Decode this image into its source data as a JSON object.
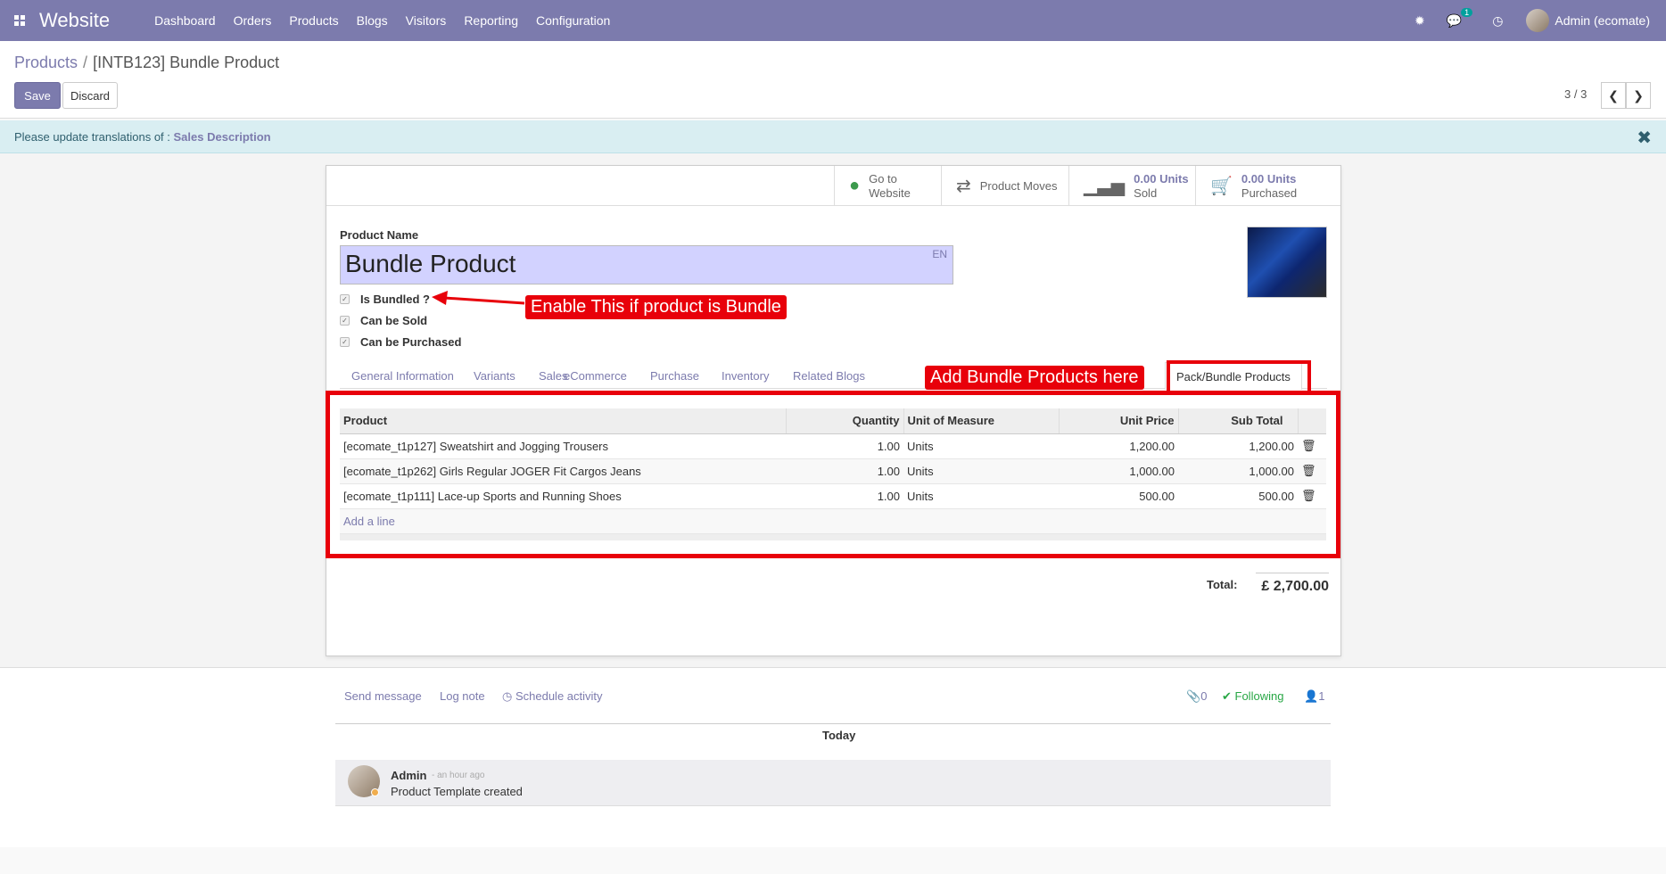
{
  "nav": {
    "brand": "Website",
    "menu": [
      "Dashboard",
      "Orders",
      "Products",
      "Blogs",
      "Visitors",
      "Reporting",
      "Configuration"
    ],
    "messages_badge": "1",
    "user": "Admin (ecomate)"
  },
  "breadcrumb": {
    "parent": "Products",
    "separator": "/",
    "current": "[INTB123] Bundle Product"
  },
  "buttons": {
    "save": "Save",
    "discard": "Discard"
  },
  "pager": {
    "value": "3 / 3"
  },
  "alert": {
    "text": "Please update translations of : ",
    "field": "Sales Description"
  },
  "stat_buttons": {
    "website": {
      "line1": "Go to",
      "line2": "Website"
    },
    "moves": {
      "label": "Product Moves"
    },
    "sold": {
      "value": "0.00 Units",
      "label": "Sold"
    },
    "purchased": {
      "value": "0.00 Units",
      "label": "Purchased"
    }
  },
  "form": {
    "name_label": "Product Name",
    "name_value": "Bundle Product",
    "lang": "EN",
    "checkboxes": [
      "Is Bundled ?",
      "Can be Sold",
      "Can be Purchased"
    ]
  },
  "tabs": [
    "General Information",
    "Variants",
    "Sales",
    "eCommerce",
    "Purchase",
    "Inventory",
    "Related Blogs",
    "Pack/Bundle Products"
  ],
  "annotations": {
    "bundled": "Enable This if product is Bundle",
    "bundle_products": "Add Bundle Products here"
  },
  "grid": {
    "headers": [
      "Product",
      "Quantity",
      "Unit of Measure",
      "Unit Price",
      "Sub Total"
    ],
    "rows": [
      {
        "product": "[ecomate_t1p127] Sweatshirt and Jogging Trousers",
        "qty": "1.00",
        "uom": "Units",
        "price": "1,200.00",
        "subtotal": "1,200.00"
      },
      {
        "product": "[ecomate_t1p262] Girls Regular JOGER Fit Cargos Jeans",
        "qty": "1.00",
        "uom": "Units",
        "price": "1,000.00",
        "subtotal": "1,000.00"
      },
      {
        "product": "[ecomate_t1p111] Lace-up Sports and Running Shoes",
        "qty": "1.00",
        "uom": "Units",
        "price": "500.00",
        "subtotal": "500.00"
      }
    ],
    "add_line": "Add a line"
  },
  "total": {
    "label": "Total:",
    "value": "£ 2,700.00"
  },
  "chatter": {
    "send_message": "Send message",
    "log_note": "Log note",
    "schedule": "Schedule activity",
    "attachments": "0",
    "following": "Following",
    "followers": "1",
    "today": "Today",
    "message": {
      "author": "Admin",
      "time": "- an hour ago",
      "body": "Product Template created"
    }
  },
  "colors": {
    "primary": "#7c7bad",
    "annotation": "#e8000a",
    "alert_bg": "#d9eef2"
  }
}
